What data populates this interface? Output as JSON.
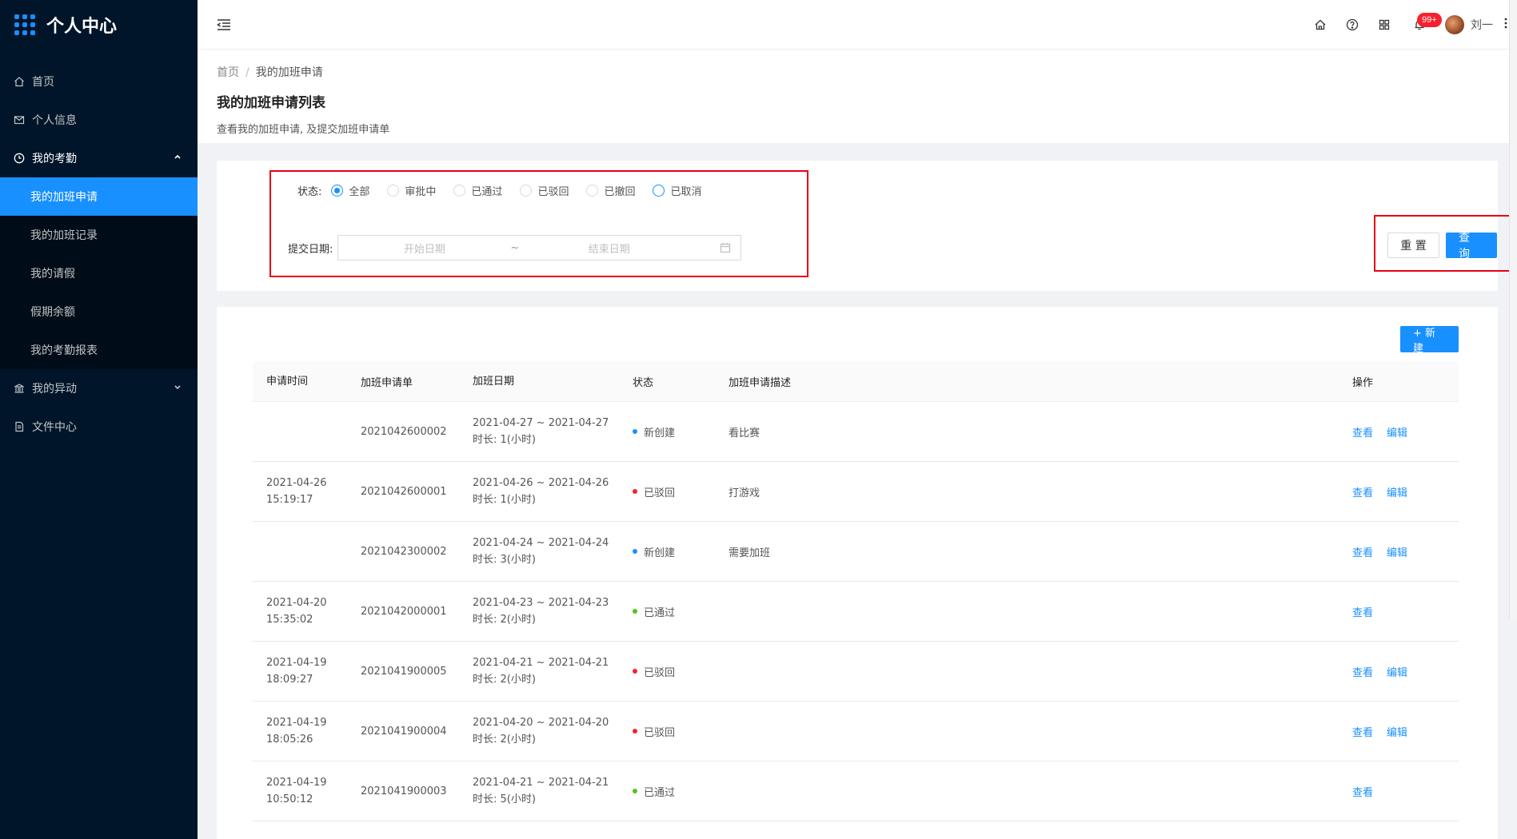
{
  "app": {
    "title": "个人中心"
  },
  "sidebar": {
    "items": [
      {
        "label": "首页",
        "icon": "home-icon"
      },
      {
        "label": "个人信息",
        "icon": "mail-icon"
      },
      {
        "label": "我的考勤",
        "icon": "clock-icon",
        "open": true
      },
      {
        "label": "我的异动",
        "icon": "bank-icon"
      },
      {
        "label": "文件中心",
        "icon": "file-icon"
      }
    ],
    "attendance_sub": [
      {
        "label": "我的加班申请",
        "active": true
      },
      {
        "label": "我的加班记录"
      },
      {
        "label": "我的请假"
      },
      {
        "label": "假期余额"
      },
      {
        "label": "我的考勤报表"
      }
    ]
  },
  "topbar": {
    "notification_count": "99+",
    "username": "刘一"
  },
  "breadcrumb": {
    "home": "首页",
    "sep": "/",
    "current": "我的加班申请"
  },
  "page": {
    "title": "我的加班申请列表",
    "desc": "查看我的加班申请, 及提交加班申请单"
  },
  "filter": {
    "status_label": "状态:",
    "status_options": [
      "全部",
      "审批中",
      "已通过",
      "已驳回",
      "已撤回",
      "已取消"
    ],
    "status_selected": "全部",
    "date_label": "提交日期:",
    "start_placeholder": "开始日期",
    "range_sep": "~",
    "end_placeholder": "结束日期",
    "reset_label": "重 置",
    "query_label": "查 询"
  },
  "table": {
    "new_label": "+ 新建",
    "columns": [
      "申请时间",
      "加班申请单",
      "加班日期",
      "状态",
      "加班申请描述",
      "操作"
    ],
    "rows": [
      {
        "time1": "",
        "time2": "",
        "no": "2021042600002",
        "dates": "2021-04-27 ~ 2021-04-27",
        "dur": "时长: 1(小时)",
        "status": "新创建",
        "color": "#1890ff",
        "desc": "看比赛",
        "view": "查看",
        "edit": "编辑"
      },
      {
        "time1": "2021-04-26",
        "time2": "15:19:17",
        "no": "2021042600001",
        "dates": "2021-04-26 ~ 2021-04-26",
        "dur": "时长: 1(小时)",
        "status": "已驳回",
        "color": "#f5222d",
        "desc": "打游戏",
        "view": "查看",
        "edit": "编辑"
      },
      {
        "time1": "",
        "time2": "",
        "no": "2021042300002",
        "dates": "2021-04-24 ~ 2021-04-24",
        "dur": "时长: 3(小时)",
        "status": "新创建",
        "color": "#1890ff",
        "desc": "需要加班",
        "view": "查看",
        "edit": "编辑"
      },
      {
        "time1": "2021-04-20",
        "time2": "15:35:02",
        "no": "2021042000001",
        "dates": "2021-04-23 ~ 2021-04-23",
        "dur": "时长: 2(小时)",
        "status": "已通过",
        "color": "#52c41a",
        "desc": "",
        "view": "查看",
        "edit": ""
      },
      {
        "time1": "2021-04-19",
        "time2": "18:09:27",
        "no": "2021041900005",
        "dates": "2021-04-21 ~ 2021-04-21",
        "dur": "时长: 2(小时)",
        "status": "已驳回",
        "color": "#f5222d",
        "desc": "",
        "view": "查看",
        "edit": "编辑"
      },
      {
        "time1": "2021-04-19",
        "time2": "18:05:26",
        "no": "2021041900004",
        "dates": "2021-04-20 ~ 2021-04-20",
        "dur": "时长: 2(小时)",
        "status": "已驳回",
        "color": "#f5222d",
        "desc": "",
        "view": "查看",
        "edit": "编辑"
      },
      {
        "time1": "2021-04-19",
        "time2": "10:50:12",
        "no": "2021041900003",
        "dates": "2021-04-21 ~ 2021-04-21",
        "dur": "时长: 5(小时)",
        "status": "已通过",
        "color": "#52c41a",
        "desc": "",
        "view": "查看",
        "edit": ""
      }
    ]
  },
  "colors": {
    "sidebar_bg": "#001529",
    "submenu_bg": "#000c17",
    "primary": "#1890ff",
    "highlight_box": "#e60012"
  }
}
